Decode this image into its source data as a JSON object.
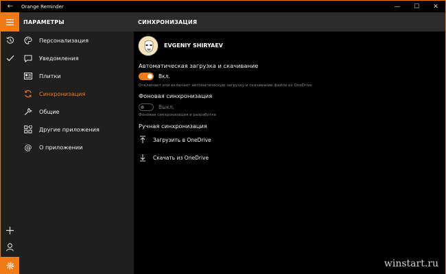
{
  "window": {
    "title": "Orange Reminder",
    "controls": {
      "minimize": "—",
      "maximize": "☐",
      "close": "✕"
    },
    "accent_color": "#f07a16"
  },
  "header": {
    "left_title": "ПАРАМЕТРЫ",
    "right_title": "СИНХРОНИЗАЦИЯ"
  },
  "rail": {
    "icons": [
      "hamburger-icon",
      "history-icon",
      "check-icon",
      "add-icon",
      "person-icon",
      "gear-icon"
    ]
  },
  "sidebar": {
    "items": [
      {
        "label": "Персонализация",
        "icon": "palette-icon"
      },
      {
        "label": "Уведомления",
        "icon": "message-icon"
      },
      {
        "label": "Плитки",
        "icon": "tiles-icon"
      },
      {
        "label": "Синхронизация",
        "icon": "sync-icon",
        "active": true
      },
      {
        "label": "Общие",
        "icon": "wrench-icon"
      },
      {
        "label": "Другие приложения",
        "icon": "apps-icon"
      },
      {
        "label": "О приложении",
        "icon": "at-icon"
      }
    ]
  },
  "content": {
    "user_name": "EVGENIY SHIRYAEV",
    "auto_sync": {
      "title": "Автоматическая загрузка и скачивание",
      "state_label": "Вкл.",
      "enabled": true,
      "hint": "Отключает или включает автоматическую загрузку и скачивание файла из OneDrive"
    },
    "background_sync": {
      "title": "Фоновая синхронизация",
      "state_label": "Выкл.",
      "enabled": false,
      "hint": "Фоновая синхронизация в разработке"
    },
    "manual_sync": {
      "title": "Ручная синхронизация",
      "upload_label": "Загрузить в OneDrive",
      "download_label": "Скачать из OneDrive"
    }
  },
  "watermark": "winstart.ru"
}
